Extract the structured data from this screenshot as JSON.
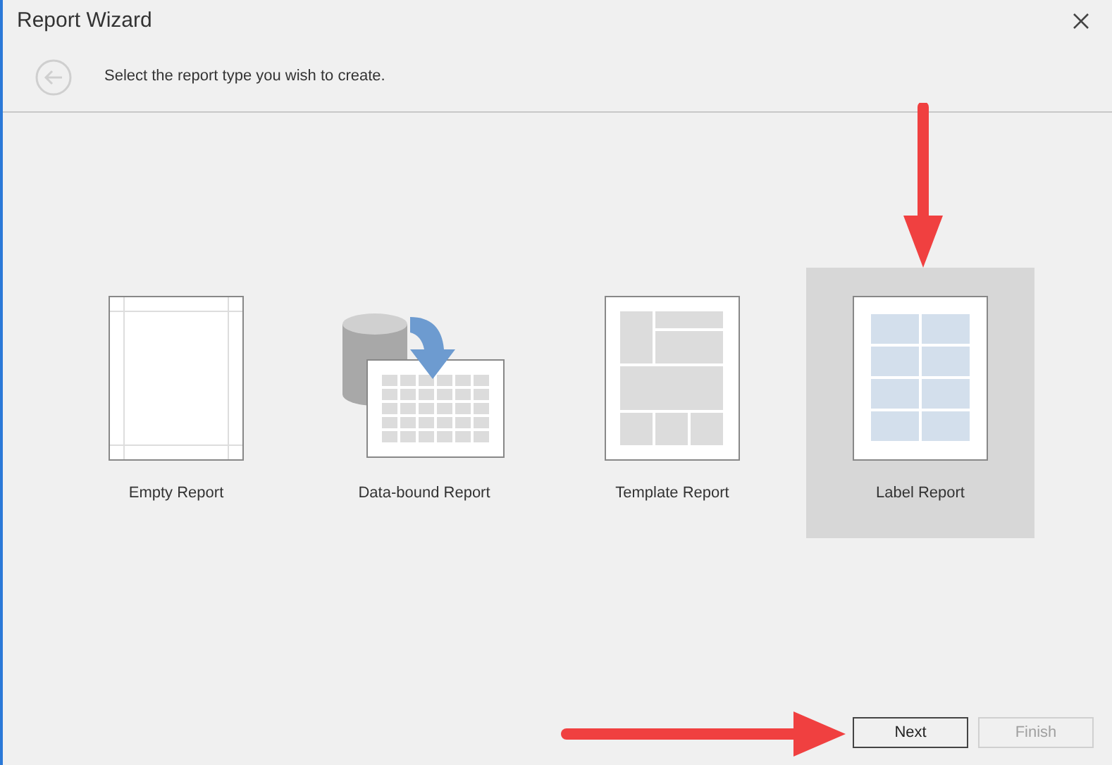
{
  "window": {
    "title": "Report Wizard"
  },
  "header": {
    "text": "Select the report type you wish to create."
  },
  "report_types": [
    {
      "label": "Empty Report",
      "kind": "empty",
      "selected": false
    },
    {
      "label": "Data-bound Report",
      "kind": "databound",
      "selected": false
    },
    {
      "label": "Template Report",
      "kind": "template",
      "selected": false
    },
    {
      "label": "Label Report",
      "kind": "label",
      "selected": true
    }
  ],
  "buttons": [
    {
      "label": "Next",
      "disabled": false
    },
    {
      "label": "Finish",
      "disabled": true
    }
  ]
}
